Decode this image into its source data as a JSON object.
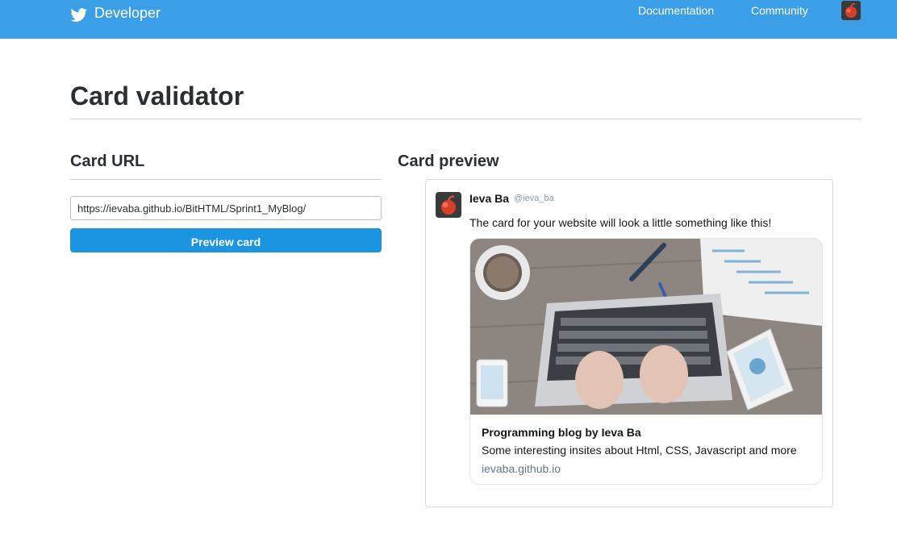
{
  "header": {
    "brand": "Developer",
    "nav": [
      {
        "label": "Documentation"
      },
      {
        "label": "Community"
      }
    ],
    "icons": {
      "logo": "twitter-bird-icon",
      "user": "user-avatar"
    }
  },
  "page": {
    "title": "Card validator"
  },
  "card_url": {
    "heading": "Card URL",
    "input_value": "https://ievaba.github.io/BitHTML/Sprint1_MyBlog/",
    "button_label": "Preview card"
  },
  "card_preview": {
    "heading": "Card preview",
    "tweet": {
      "name": "Ieva Ba",
      "handle": "@ieva_ba",
      "text": "The card for your website will look a little something like this!"
    },
    "card": {
      "title": "Programming blog by Ieva Ba",
      "description": "Some interesting insites about Html, CSS, Javascript and more",
      "domain": "ievaba.github.io"
    }
  },
  "colors": {
    "header_bg": "#3a9fe6",
    "button_bg": "#1b95e0",
    "domain_text": "#657786"
  }
}
